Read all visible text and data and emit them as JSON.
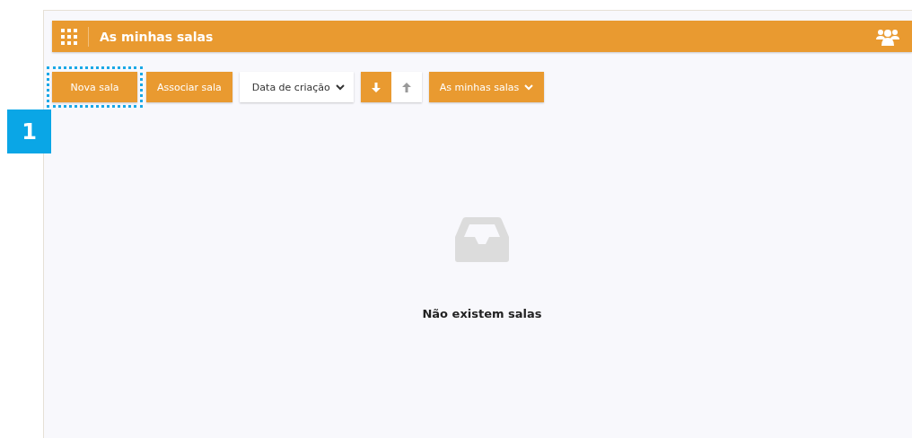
{
  "header": {
    "title": "As minhas salas"
  },
  "actions": [
    {
      "label": "Nova sala",
      "focused": true
    },
    {
      "label": "Associar sala",
      "focused": false
    }
  ],
  "sort": {
    "label": "Data de criação"
  },
  "sort_direction": [
    {
      "kind": "descending",
      "selected": true
    },
    {
      "kind": "ascending",
      "selected": false
    }
  ],
  "filter": {
    "label": "As minhas salas"
  },
  "empty_state": {
    "message": "Não existem salas"
  },
  "callout": {
    "number": "1"
  }
}
